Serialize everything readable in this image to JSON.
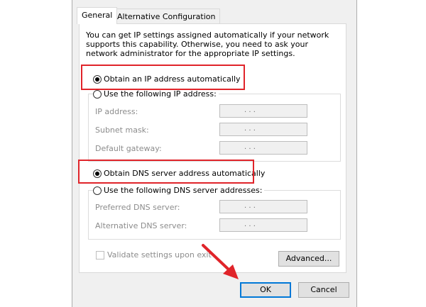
{
  "tabs": [
    "General",
    "Alternative Configuration"
  ],
  "description": "You can get IP settings assigned automatically if your network supports this capability. Otherwise, you need to ask your network administrator for the appropriate IP settings.",
  "ip_section": {
    "auto_label": "Obtain an IP address automatically",
    "manual_label": "Use the following IP address:",
    "fields": [
      "IP address:",
      "Subnet mask:",
      "Default gateway:"
    ]
  },
  "dns_section": {
    "auto_label": "Obtain DNS server address automatically",
    "manual_label": "Use the following DNS server addresses:",
    "fields": [
      "Preferred DNS server:",
      "Alternative DNS server:"
    ]
  },
  "validate_label": "Validate settings upon exit",
  "advanced_label": "Advanced...",
  "ok_label": "OK",
  "cancel_label": "Cancel",
  "ip_dots": ". . .",
  "colors": {
    "highlight": "#e0242a",
    "arrow": "#e0242a",
    "focus": "#0078d7"
  },
  "icons": {
    "annotation_arrow": "red-arrow-icon"
  }
}
